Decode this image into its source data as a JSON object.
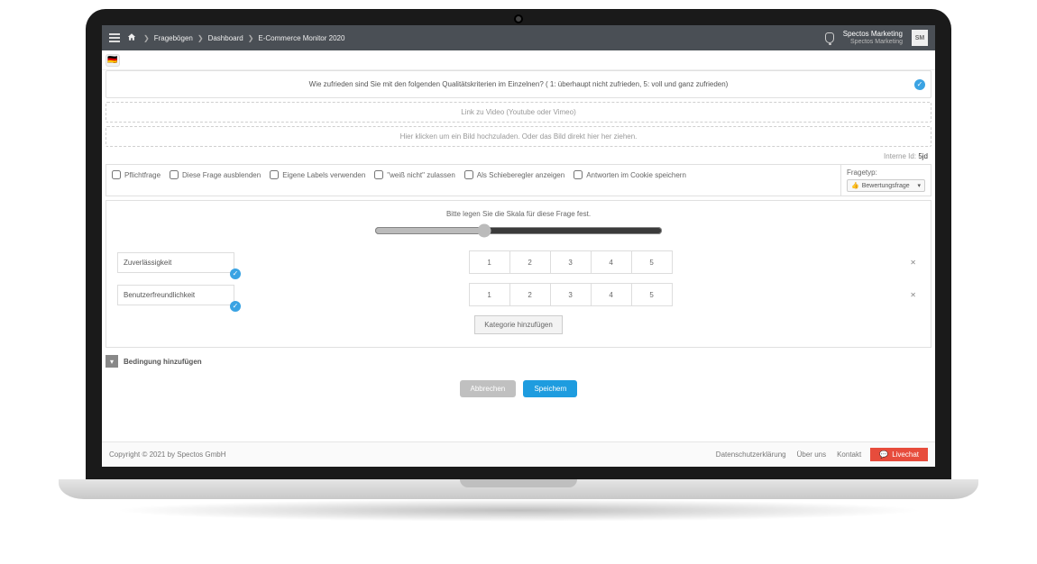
{
  "header": {
    "breadcrumbs": [
      "Fragebögen",
      "Dashboard",
      "E-Commerce Monitor 2020"
    ],
    "user_name": "Spectos Marketing",
    "user_org": "Spectos Marketing",
    "avatar_initials": "SM"
  },
  "question": {
    "title": "Wie zufrieden sind Sie mit den folgenden Qualitätskriterien im Einzelnen? ( 1: überhaupt nicht zufrieden, 5: voll und ganz zufrieden)",
    "video_placeholder": "Link zu Video (Youtube oder Vimeo)",
    "image_placeholder": "Hier klicken um ein Bild hochzuladen. Oder das Bild direkt hier her ziehen.",
    "internal_id_label": "Interne Id:",
    "internal_id_value": "5jd"
  },
  "options": {
    "checkboxes": [
      "Pflichtfrage",
      "Diese Frage ausblenden",
      "Eigene Labels verwenden",
      "\"weiß nicht\" zulassen",
      "Als Schieberegler anzeigen",
      "Antworten im Cookie speichern"
    ],
    "type_label": "Fragetyp:",
    "type_value": "Bewertungsfrage"
  },
  "scale": {
    "title": "Bitte legen Sie die Skala für diese Frage fest.",
    "values": [
      "1",
      "2",
      "3",
      "4",
      "5"
    ],
    "categories": [
      "Zuverlässigkeit",
      "Benutzerfreundlichkeit"
    ],
    "add_label": "Kategorie hinzufügen"
  },
  "condition_label": "Bedingung hinzufügen",
  "buttons": {
    "cancel": "Abbrechen",
    "save": "Speichern"
  },
  "footer": {
    "copyright": "Copyright © 2021 by Spectos GmbH",
    "links": [
      "Datenschutzerklärung",
      "Über uns",
      "Kontakt"
    ],
    "livechat": "Livechat"
  }
}
